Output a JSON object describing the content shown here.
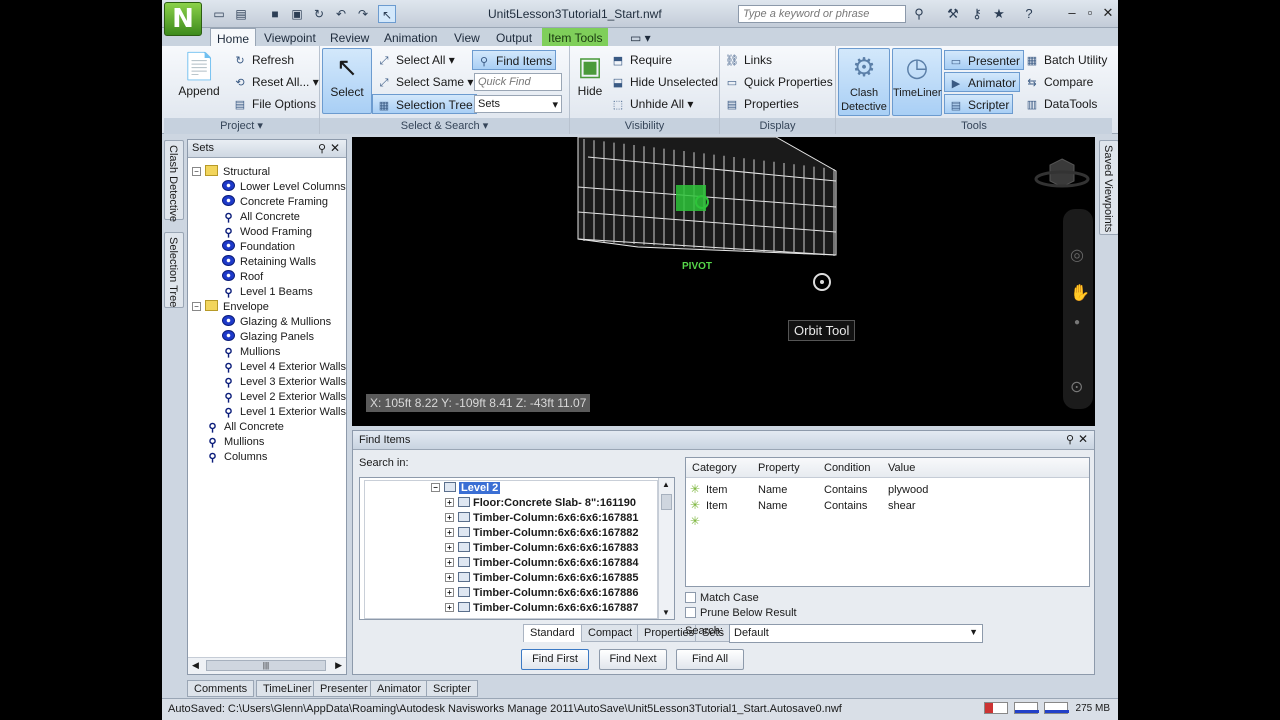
{
  "window": {
    "title": "Unit5Lesson3Tutorial1_Start.nwf",
    "search_placeholder": "Type a keyword or phrase"
  },
  "tabs": [
    "Home",
    "Viewpoint",
    "Review",
    "Animation",
    "View",
    "Output",
    "Item Tools"
  ],
  "ribbon": {
    "project": {
      "label": "Project",
      "append": "Append",
      "refresh": "Refresh",
      "reset_all": "Reset All...",
      "file_options": "File Options"
    },
    "select_search": {
      "label": "Select & Search",
      "select": "Select",
      "select_all": "Select All",
      "select_same": "Select Same",
      "selection_tree": "Selection Tree",
      "find_items": "Find Items",
      "quick_find_placeholder": "Quick Find",
      "sets": "Sets"
    },
    "visibility": {
      "label": "Visibility",
      "hide": "Hide",
      "require": "Require",
      "hide_unselected": "Hide Unselected",
      "unhide_all": "Unhide All"
    },
    "display": {
      "label": "Display",
      "links": "Links",
      "quick_properties": "Quick Properties",
      "properties": "Properties"
    },
    "tools": {
      "label": "Tools",
      "clash_detective": "Clash Detective",
      "timeliner": "TimeLiner",
      "presenter": "Presenter",
      "animator": "Animator",
      "scripter": "Scripter",
      "batch_utility": "Batch Utility",
      "compare": "Compare",
      "datatools": "DataTools"
    }
  },
  "side_tabs": {
    "clash": "Clash Detective",
    "selection": "Selection Tree",
    "saved": "Saved Viewpoints"
  },
  "sets_panel": {
    "title": "Sets",
    "items": [
      {
        "label": "Structural",
        "icon": "folder-icon",
        "indent": 0,
        "toggle": "−"
      },
      {
        "label": "Lower Level Columns",
        "icon": "selection-set-icon",
        "indent": 1
      },
      {
        "label": "Concrete Framing",
        "icon": "selection-set-icon",
        "indent": 1
      },
      {
        "label": "All Concrete",
        "icon": "search-set-icon",
        "indent": 1
      },
      {
        "label": "Wood Framing",
        "icon": "search-set-icon",
        "indent": 1
      },
      {
        "label": "Foundation",
        "icon": "selection-set-icon",
        "indent": 1
      },
      {
        "label": "Retaining Walls",
        "icon": "selection-set-icon",
        "indent": 1
      },
      {
        "label": "Roof",
        "icon": "selection-set-icon",
        "indent": 1
      },
      {
        "label": "Level 1 Beams",
        "icon": "search-set-icon",
        "indent": 1
      },
      {
        "label": "Envelope",
        "icon": "folder-icon",
        "indent": 0,
        "toggle": "−"
      },
      {
        "label": "Glazing & Mullions",
        "icon": "selection-set-icon",
        "indent": 1
      },
      {
        "label": "Glazing Panels",
        "icon": "selection-set-icon",
        "indent": 1
      },
      {
        "label": "Mullions",
        "icon": "search-set-icon",
        "indent": 1
      },
      {
        "label": "Level 4 Exterior Walls",
        "icon": "search-set-icon",
        "indent": 1
      },
      {
        "label": "Level 3 Exterior Walls",
        "icon": "search-set-icon",
        "indent": 1
      },
      {
        "label": "Level 2 Exterior Walls",
        "icon": "search-set-icon",
        "indent": 1
      },
      {
        "label": "Level 1 Exterior Walls",
        "icon": "search-set-icon",
        "indent": 1
      },
      {
        "label": "All Concrete",
        "icon": "search-set-icon",
        "indent": 0
      },
      {
        "label": "Mullions",
        "icon": "search-set-icon",
        "indent": 0
      },
      {
        "label": "Columns",
        "icon": "search-set-icon",
        "indent": 0
      }
    ]
  },
  "viewport": {
    "coords": "X: 105ft 8.22  Y: -109ft 8.41  Z: -43ft 11.07",
    "tooltip": "Orbit Tool",
    "pivot": "PIVOT"
  },
  "find_items": {
    "title": "Find Items",
    "search_in_label": "Search in:",
    "tree": [
      "Level 2",
      "Floor:Concrete Slab- 8\":161190",
      "Timber-Column:6x6:6x6:167881",
      "Timber-Column:6x6:6x6:167882",
      "Timber-Column:6x6:6x6:167883",
      "Timber-Column:6x6:6x6:167884",
      "Timber-Column:6x6:6x6:167885",
      "Timber-Column:6x6:6x6:167886",
      "Timber-Column:6x6:6x6:167887"
    ],
    "tabs": [
      "Standard",
      "Compact",
      "Properties",
      "Sets"
    ],
    "columns": [
      "Category",
      "Property",
      "Condition",
      "Value"
    ],
    "conditions": [
      {
        "category": "Item",
        "property": "Name",
        "condition": "Contains",
        "value": "plywood"
      },
      {
        "category": "Item",
        "property": "Name",
        "condition": "Contains",
        "value": "shear"
      }
    ],
    "match_case": "Match Case",
    "prune": "Prune Below Result",
    "search_label": "Search:",
    "search_value": "Default",
    "buttons": {
      "find_first": "Find First",
      "find_next": "Find Next",
      "find_all": "Find All"
    }
  },
  "bottom_tabs": [
    "Comments",
    "TimeLiner",
    "Presenter",
    "Animator",
    "Scripter"
  ],
  "status": {
    "text": "AutoSaved: C:\\Users\\Glenn\\AppData\\Roaming\\Autodesk Navisworks Manage 2011\\AutoSave\\Unit5Lesson3Tutorial1_Start.Autosave0.nwf",
    "memory": "275 MB"
  }
}
